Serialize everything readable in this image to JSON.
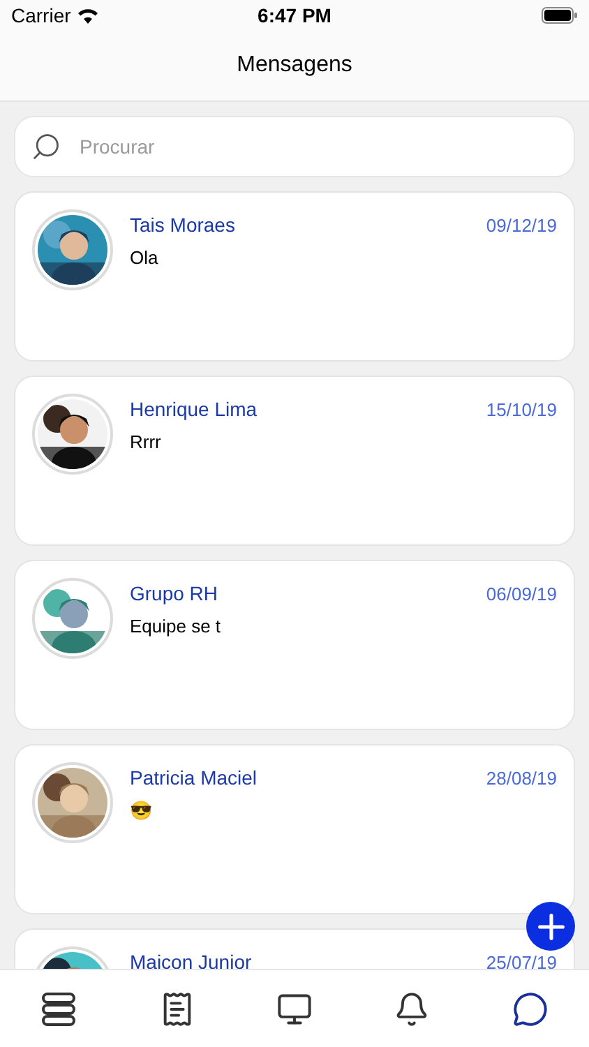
{
  "status_bar": {
    "carrier": "Carrier",
    "time": "6:47 PM"
  },
  "header": {
    "title": "Mensagens"
  },
  "search": {
    "placeholder": "Procurar"
  },
  "conversations": [
    {
      "name": "Tais Moraes",
      "date": "09/12/19",
      "message": "Ola"
    },
    {
      "name": "Henrique Lima",
      "date": "15/10/19",
      "message": "Rrrr"
    },
    {
      "name": "Grupo RH",
      "date": "06/09/19",
      "message": "Equipe se t"
    },
    {
      "name": "Patricia Maciel",
      "date": "28/08/19",
      "message": "😎"
    },
    {
      "name": "Maicon Junior",
      "date": "25/07/19"
    }
  ],
  "tab_bar": [
    {
      "kind": "stack",
      "selected": false
    },
    {
      "kind": "receipt",
      "selected": false
    },
    {
      "kind": "monitor",
      "selected": false
    },
    {
      "kind": "bell",
      "selected": false
    },
    {
      "kind": "chat",
      "selected": true
    }
  ]
}
